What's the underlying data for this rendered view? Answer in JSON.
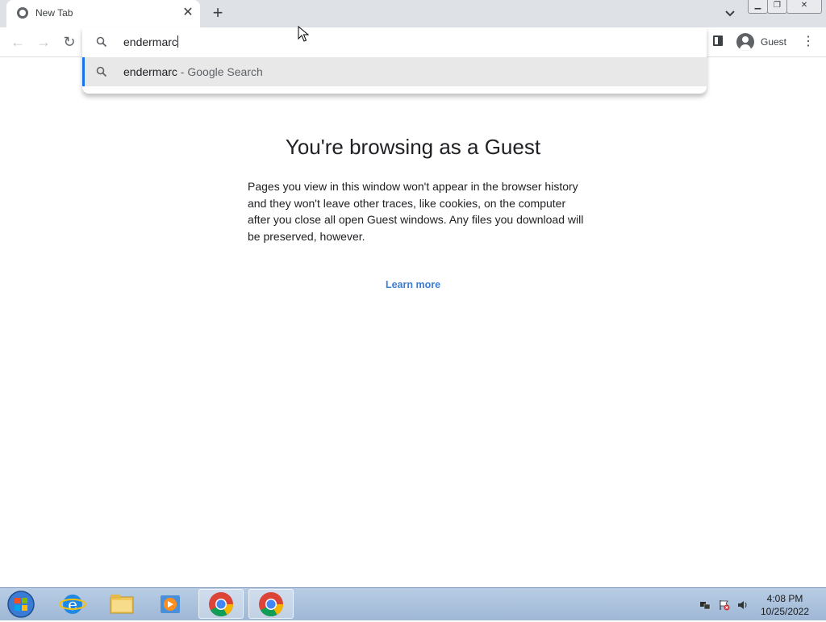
{
  "browser": {
    "tab": {
      "title": "New Tab"
    },
    "toolbar": {
      "profile_label": "Guest"
    }
  },
  "omnibox": {
    "input_value": "endermarc",
    "suggestion": {
      "query": "endermarc",
      "separator": " - ",
      "source": "Google Search"
    }
  },
  "page": {
    "heading": "You're browsing as a Guest",
    "description": "Pages you view in this window won't appear in the browser history and they won't leave other traces, like cookies, on the computer after you close all open Guest windows. Any files you download will be preserved, however.",
    "learn_more": "Learn more"
  },
  "taskbar": {
    "clock_time": "4:08 PM",
    "clock_date": "10/25/2022"
  },
  "colors": {
    "accent": "#1a73e8",
    "link": "#3c7ed4"
  }
}
